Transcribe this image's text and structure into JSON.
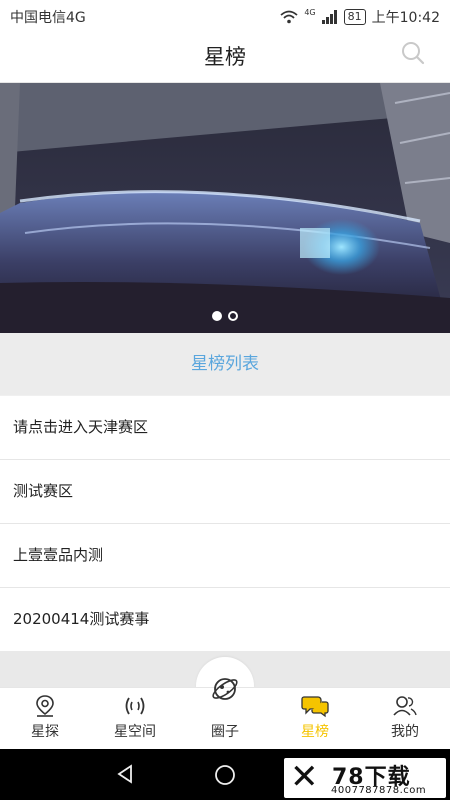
{
  "status_bar": {
    "carrier": "中国电信4G",
    "network_badge": "4G",
    "battery": "81",
    "time": "上午10:42"
  },
  "header": {
    "title": "星榜",
    "search_icon": "search-icon"
  },
  "banner": {
    "image_subject": "stadium-concert-photo",
    "dots": [
      {
        "active": true
      },
      {
        "active": false
      }
    ]
  },
  "section": {
    "title": "星榜列表"
  },
  "list": {
    "items": [
      {
        "label": "请点击进入天津赛区"
      },
      {
        "label": "测试赛区"
      },
      {
        "label": "上壹壹品内测"
      },
      {
        "label": "20200414测试赛事"
      }
    ]
  },
  "tabbar": {
    "active_color": "#f5c400",
    "tabs": [
      {
        "label": "星探",
        "icon": "location-pin-icon"
      },
      {
        "label": "星空间",
        "icon": "broadcast-icon"
      },
      {
        "label": "圈子",
        "icon": "planet-icon"
      },
      {
        "label": "星榜",
        "icon": "chat-bubbles-icon",
        "active": true
      },
      {
        "label": "我的",
        "icon": "users-icon"
      }
    ]
  },
  "watermark": {
    "brand": "78下载",
    "url": "4007787878.com"
  }
}
